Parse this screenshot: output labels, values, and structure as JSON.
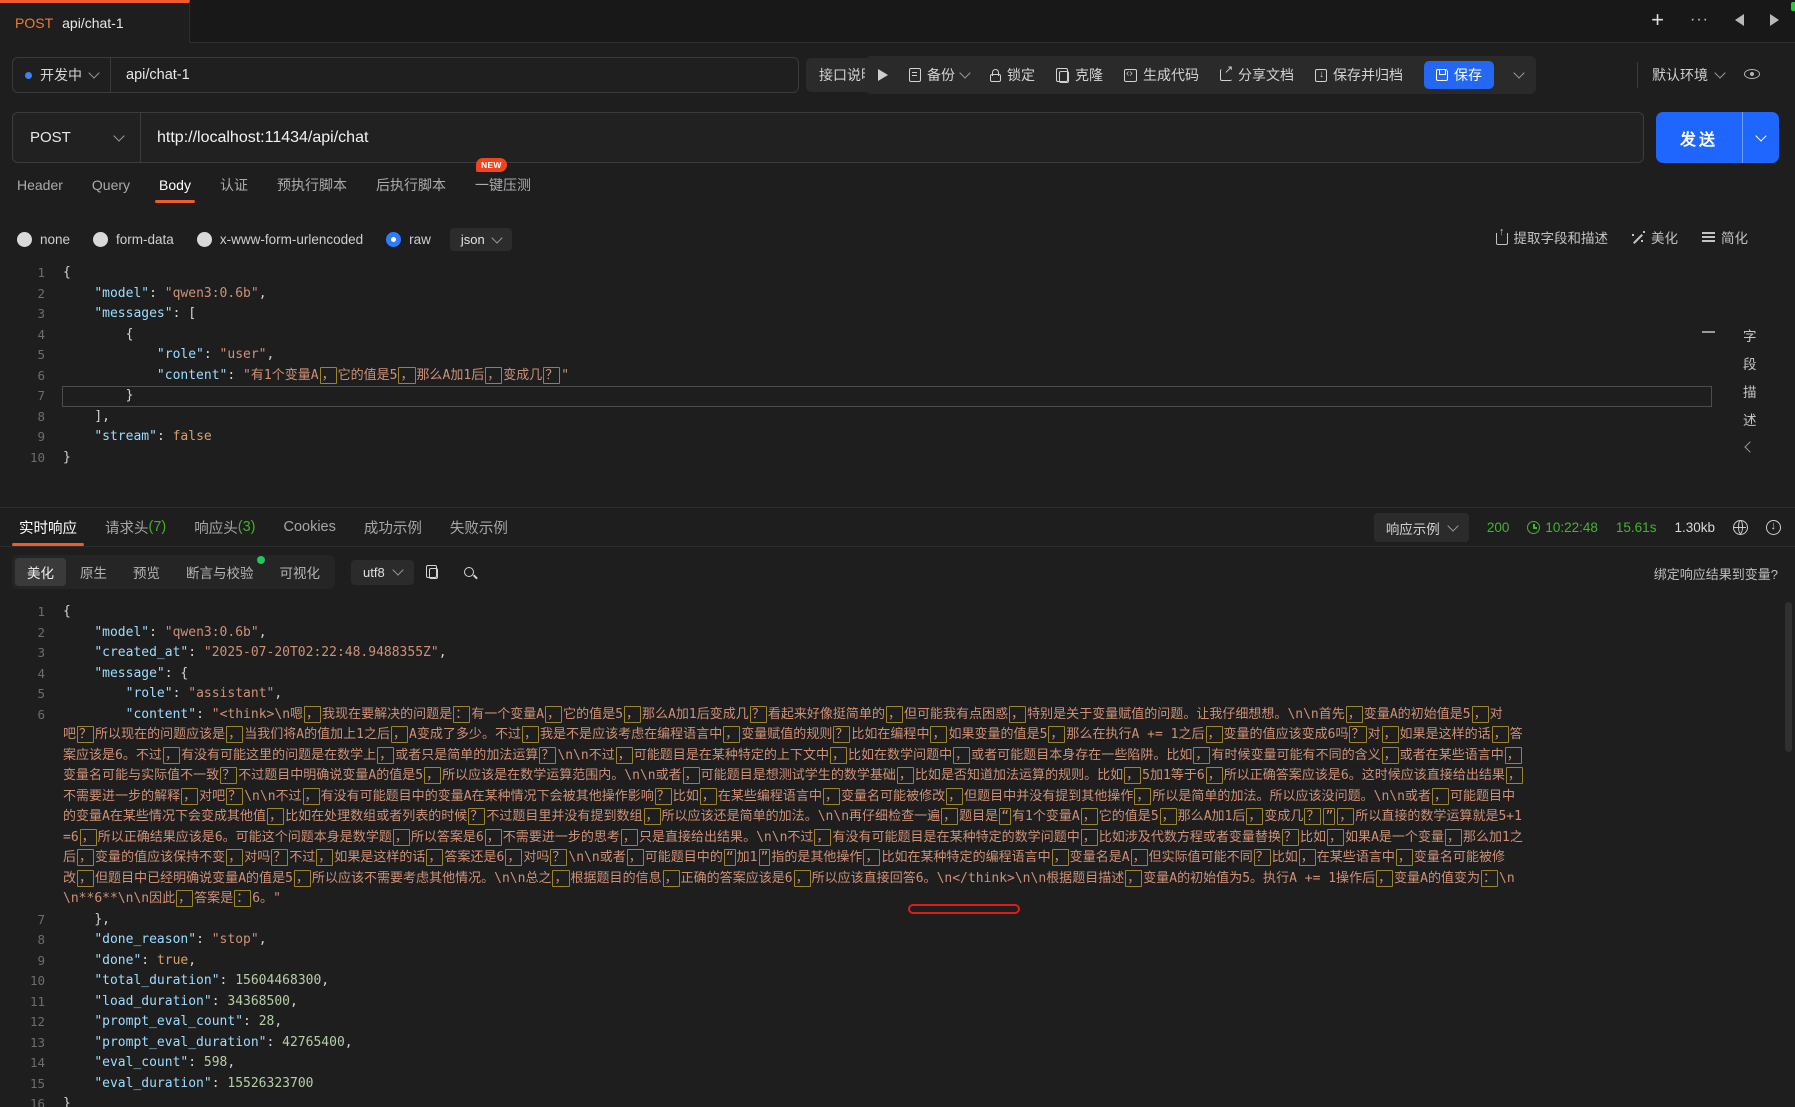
{
  "window": {
    "tab_method": "POST",
    "tab_name": "api/chat-1"
  },
  "topbar": {
    "status_label": "开发中",
    "name_value": "api/chat-1",
    "doc_btn": "接口说明",
    "backup": "备份",
    "lock": "锁定",
    "clone": "克隆",
    "gen_code": "生成代码",
    "share_doc": "分享文档",
    "save_archive": "保存并归档",
    "save": "保存",
    "env": "默认环境"
  },
  "request_bar": {
    "method": "POST",
    "url": "http://localhost:11434/api/chat",
    "send_label": "发送"
  },
  "request_tabs": {
    "items": [
      "Header",
      "Query",
      "Body",
      "认证",
      "预执行脚本",
      "后执行脚本",
      "一键压测"
    ],
    "active": "Body",
    "new_badge": "NEW"
  },
  "body_bar": {
    "types": [
      "none",
      "form-data",
      "x-www-form-urlencoded",
      "raw"
    ],
    "selected": "raw",
    "format": "json",
    "actions": [
      "提取字段和描述",
      "美化",
      "简化"
    ]
  },
  "field_panel": {
    "chars": [
      "字",
      "段",
      "描",
      "述"
    ]
  },
  "request_editor": {
    "boxed_chars": "，：？“”！；、",
    "lines": [
      {
        "n": 1,
        "toks": [
          [
            "pl",
            "{"
          ]
        ]
      },
      {
        "n": 2,
        "toks": [
          [
            "pl",
            "    "
          ],
          [
            "k",
            "\"model\""
          ],
          [
            "pl",
            ": "
          ],
          [
            "s",
            "\"qwen3:0.6b\""
          ],
          [
            "pl",
            ","
          ]
        ]
      },
      {
        "n": 3,
        "toks": [
          [
            "pl",
            "    "
          ],
          [
            "k",
            "\"messages\""
          ],
          [
            "pl",
            ": ["
          ]
        ]
      },
      {
        "n": 4,
        "toks": [
          [
            "pl",
            "        {"
          ]
        ]
      },
      {
        "n": 5,
        "toks": [
          [
            "pl",
            "            "
          ],
          [
            "k",
            "\"role\""
          ],
          [
            "pl",
            ": "
          ],
          [
            "s",
            "\"user\""
          ],
          [
            "pl",
            ","
          ]
        ]
      },
      {
        "n": 6,
        "toks": [
          [
            "pl",
            "            "
          ],
          [
            "k",
            "\"content\""
          ],
          [
            "pl",
            ": "
          ],
          [
            "cjk",
            "\"有1个变量A，它的值是5，那么A加1后，变成几？\""
          ]
        ]
      },
      {
        "n": 7,
        "cur": true,
        "toks": [
          [
            "pl",
            "        }"
          ]
        ]
      },
      {
        "n": 8,
        "toks": [
          [
            "pl",
            "    ],"
          ]
        ]
      },
      {
        "n": 9,
        "toks": [
          [
            "pl",
            "    "
          ],
          [
            "k",
            "\"stream\""
          ],
          [
            "pl",
            ": "
          ],
          [
            "b",
            "false"
          ]
        ]
      },
      {
        "n": 10,
        "toks": [
          [
            "pl",
            "}"
          ]
        ]
      }
    ]
  },
  "response_bar": {
    "tabs": [
      {
        "label": "实时响应",
        "count": ""
      },
      {
        "label": "请求头",
        "count": "(7)"
      },
      {
        "label": "响应头",
        "count": "(3)"
      },
      {
        "label": "Cookies",
        "count": ""
      },
      {
        "label": "成功示例",
        "count": ""
      },
      {
        "label": "失败示例",
        "count": ""
      }
    ],
    "active": "实时响应",
    "example_btn": "响应示例",
    "status_code": "200",
    "time": "10:22:48",
    "duration": "15.61s",
    "size": "1.30kb"
  },
  "response_toolbar": {
    "views": [
      "美化",
      "原生",
      "预览",
      "断言与校验",
      "可视化"
    ],
    "active": "美化",
    "encoding": "utf8",
    "bind_hint": "绑定响应结果到变量?"
  },
  "response_editor": {
    "boxed_chars": "，：？“”！；、",
    "lines": [
      {
        "n": 1,
        "toks": [
          [
            "pl",
            "{"
          ]
        ]
      },
      {
        "n": 2,
        "toks": [
          [
            "pl",
            "    "
          ],
          [
            "k",
            "\"model\""
          ],
          [
            "pl",
            ": "
          ],
          [
            "s",
            "\"qwen3:0.6b\""
          ],
          [
            "pl",
            ","
          ]
        ]
      },
      {
        "n": 3,
        "toks": [
          [
            "pl",
            "    "
          ],
          [
            "k",
            "\"created_at\""
          ],
          [
            "pl",
            ": "
          ],
          [
            "s",
            "\"2025-07-20T02:22:48.9488355Z\""
          ],
          [
            "pl",
            ","
          ]
        ]
      },
      {
        "n": 4,
        "toks": [
          [
            "pl",
            "    "
          ],
          [
            "k",
            "\"message\""
          ],
          [
            "pl",
            ": {"
          ]
        ]
      },
      {
        "n": 5,
        "toks": [
          [
            "pl",
            "        "
          ],
          [
            "k",
            "\"role\""
          ],
          [
            "pl",
            ": "
          ],
          [
            "s",
            "\"assistant\""
          ],
          [
            "pl",
            ","
          ]
        ]
      },
      {
        "n": 6,
        "toks": [
          [
            "pl",
            "        "
          ],
          [
            "k",
            "\"content\""
          ],
          [
            "pl",
            ": "
          ],
          [
            "cjk",
            "\"<think>\\n嗯，我现在要解决的问题是：有一个变量A，它的值是5，那么A加1后变成几？看起来好像挺简单的，但可能我有点困惑，特别是关于变量赋值的问题。让我仔细想想。\\n\\n首先，变量A的初始值是5，对吧？所以现在的问题应该是，当我们将A的值加上1之后，A变成了多少。不过，我是不是应该考虑在编程语言中，变量赋值的规则？比如在编程中，如果变量的值是5，那么在执行A += 1之后，变量的值应该变成6吗？对，如果是这样的话，答案应该是6。不过，有没有可能这里的问题是在数学上，或者只是简单的加法运算？\\n\\n不过，可能题目是在某种特定的上下文中，比如在数学问题中，或者可能题目本身存在一些陷阱。比如，有时候变量可能有不同的含义，或者在某些语言中，变量名可能与实际值不一致？不过题目中明确说变量A的值是5，所以应该是在数学运算范围内。\\n\\n或者，可能题目是想测试学生的数学基础，比如是否知道加法运算的规则。比如，5加1等于6，所以正确答案应该是6。这时候应该直接给出结果，不需要进一步的解释，对吧？\\n\\n不过，有没有可能题目中的变量A在某种情况下会被其他操作影响？比如，在某些编程语言中，变量名可能被修改，但题目中并没有提到其他操作，所以是简单的加法。所以应该没问题。\\n\\n或者，可能题目中的变量A在某些情况下会变成其他值，比如在处理数组或者列表的时候？不过题目里并没有提到数组，所以应该还是简单的加法。\\n\\n再仔细检查一遍，题目是“有1个变量A，它的值是5，那么A加1后，变成几？”，所以直接的数学运算就是5+1=6，所以正确结果应该是6。可能这个问题本身是数学题，所以答案是6，不需要进一步的思考，只是直接给出结果。\\n\\n不过，有没有可能题目是在某种特定的数学问题中，比如涉及代数方程或者变量替换？比如，如果A是一个变量，那么加1之后，变量的值应该保持不变，对吗？不过，如果是这样的话，答案还是6，对吗？\\n\\n或者，可能题目中的“加1”指的是其他操作，比如在某种特定的编程语言中，变量名是A，但实际值可能不同？比如，在某些语言中，变量名可能被修改，但题目中已经明确说变量A的值是5，所以应该不需要考虑其他情况。\\n\\n总之，根据题目的信息，正确的答案应该是6，所以应该直接回答6。\\n</think>\\n\\n根据题目描述，变量A的初始值为5。执行A += 1操作后，变量A的值变为：\\n\\n**6**\\n\\n因此，答案是：6。\""
          ]
        ]
      },
      {
        "n": 7,
        "toks": [
          [
            "pl",
            "    },"
          ]
        ]
      },
      {
        "n": 8,
        "toks": [
          [
            "pl",
            "    "
          ],
          [
            "k",
            "\"done_reason\""
          ],
          [
            "pl",
            ": "
          ],
          [
            "s",
            "\"stop\""
          ],
          [
            "pl",
            ","
          ]
        ]
      },
      {
        "n": 9,
        "toks": [
          [
            "pl",
            "    "
          ],
          [
            "k",
            "\"done\""
          ],
          [
            "pl",
            ": "
          ],
          [
            "b",
            "true"
          ],
          [
            "pl",
            ","
          ]
        ]
      },
      {
        "n": 10,
        "toks": [
          [
            "pl",
            "    "
          ],
          [
            "k",
            "\"total_duration\""
          ],
          [
            "pl",
            ": "
          ],
          [
            "nu",
            "15604468300"
          ],
          [
            "pl",
            ","
          ]
        ]
      },
      {
        "n": 11,
        "toks": [
          [
            "pl",
            "    "
          ],
          [
            "k",
            "\"load_duration\""
          ],
          [
            "pl",
            ": "
          ],
          [
            "nu",
            "34368500"
          ],
          [
            "pl",
            ","
          ]
        ]
      },
      {
        "n": 12,
        "toks": [
          [
            "pl",
            "    "
          ],
          [
            "k",
            "\"prompt_eval_count\""
          ],
          [
            "pl",
            ": "
          ],
          [
            "nu",
            "28"
          ],
          [
            "pl",
            ","
          ]
        ]
      },
      {
        "n": 13,
        "toks": [
          [
            "pl",
            "    "
          ],
          [
            "k",
            "\"prompt_eval_duration\""
          ],
          [
            "pl",
            ": "
          ],
          [
            "nu",
            "42765400"
          ],
          [
            "pl",
            ","
          ]
        ]
      },
      {
        "n": 14,
        "toks": [
          [
            "pl",
            "    "
          ],
          [
            "k",
            "\"eval_count\""
          ],
          [
            "pl",
            ": "
          ],
          [
            "nu",
            "598"
          ],
          [
            "pl",
            ","
          ]
        ]
      },
      {
        "n": 15,
        "toks": [
          [
            "pl",
            "    "
          ],
          [
            "k",
            "\"eval_duration\""
          ],
          [
            "pl",
            ": "
          ],
          [
            "nu",
            "15526323700"
          ]
        ]
      },
      {
        "n": 16,
        "toks": [
          [
            "pl",
            "}"
          ]
        ]
      }
    ]
  },
  "colors": {
    "accent_orange": "#ef5b2b",
    "accent_blue": "#1f66ff",
    "success_green": "#45b431",
    "error_red": "#e01b1b"
  }
}
